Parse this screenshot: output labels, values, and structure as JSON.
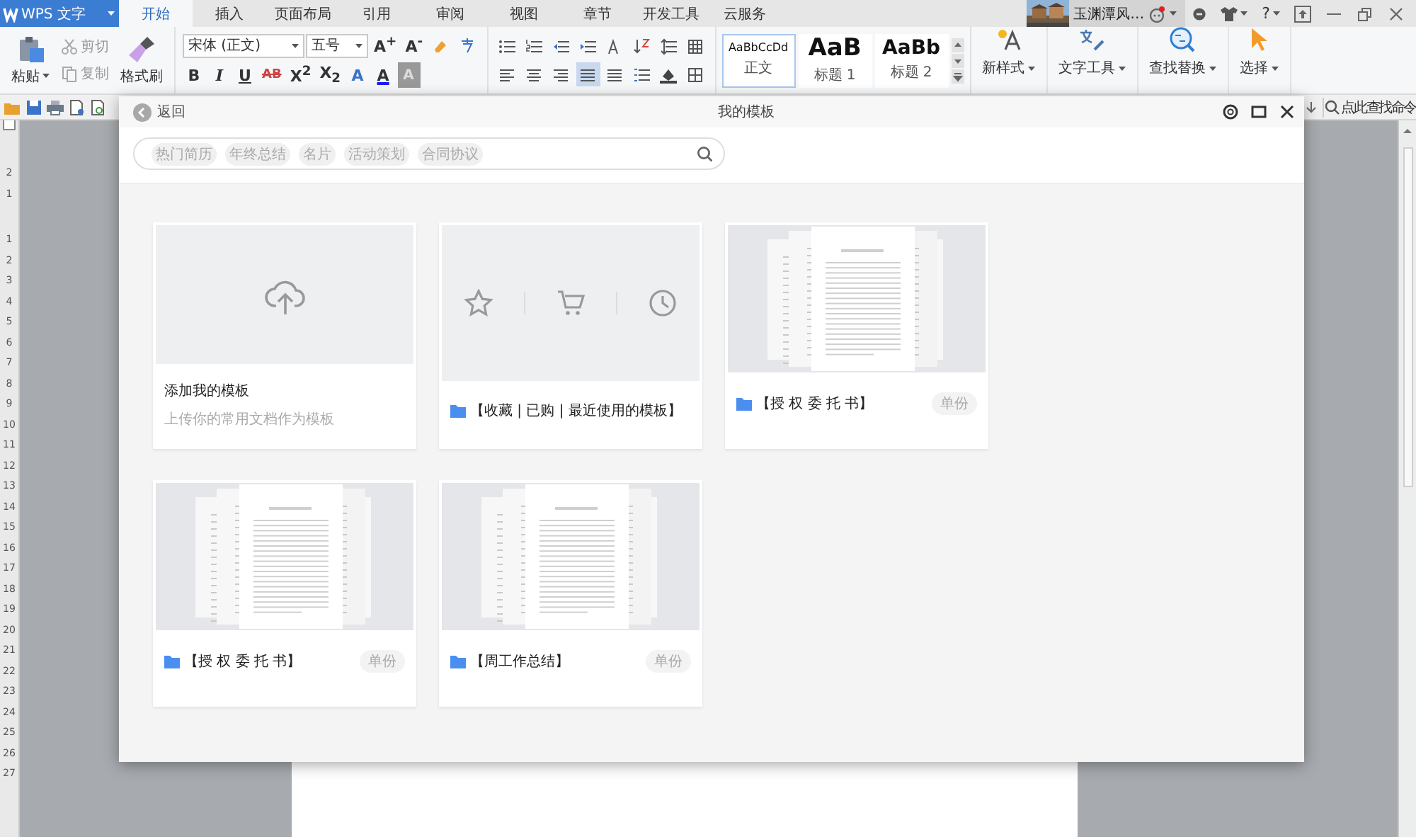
{
  "app": {
    "name": "WPS 文字",
    "help": "?",
    "user": {
      "name": "玉渊潭风…",
      "notification": true
    },
    "tabs": [
      {
        "label": "开始",
        "selected": true
      },
      {
        "label": "插入",
        "selected": false
      },
      {
        "label": "页面布局",
        "selected": false
      },
      {
        "label": "引用",
        "selected": false
      },
      {
        "label": "审阅",
        "selected": false
      },
      {
        "label": "视图",
        "selected": false
      },
      {
        "label": "章节",
        "selected": false
      },
      {
        "label": "开发工具",
        "selected": false
      },
      {
        "label": "云服务",
        "selected": false
      }
    ]
  },
  "ribbon": {
    "clipboard": {
      "paste": "粘贴",
      "cut": "剪切",
      "copy": "复制",
      "format_painter": "格式刷"
    },
    "font": {
      "name": "宋体 (正文)",
      "size": "五号",
      "grow": "A$^{+}$",
      "shrink": "A$^{-}$",
      "format_buttons": [
        "B",
        "I",
        "U",
        "AB",
        "X$^{2}$",
        "X$_{2}$",
        "A",
        "A",
        "A"
      ]
    },
    "alignments": [
      {
        "kind": "left",
        "selected": false
      },
      {
        "kind": "center",
        "selected": false
      },
      {
        "kind": "right",
        "selected": false
      },
      {
        "kind": "justify",
        "selected": true
      },
      {
        "kind": "distributed",
        "selected": false
      }
    ],
    "styles": [
      {
        "sample": "AaBbCcDd",
        "label": "正文",
        "kind": "body",
        "selected": true
      },
      {
        "sample": "AaB",
        "label": "标题 1",
        "kind": "heading1",
        "selected": false
      },
      {
        "sample": "AaBb",
        "label": "标题 2",
        "kind": "heading2",
        "selected": false
      }
    ],
    "tools": [
      {
        "label": "新样式",
        "kind": "style"
      },
      {
        "label": "文字工具",
        "kind": "text"
      },
      {
        "label": "查找替换",
        "kind": "find"
      },
      {
        "label": "选择",
        "kind": "select"
      }
    ]
  },
  "command_search": {
    "label": "点此查找命令"
  },
  "ruler": {
    "labels": [
      "2",
      "1",
      "1",
      "2",
      "3",
      "4",
      "5",
      "6",
      "7",
      "8",
      "9",
      "10",
      "11",
      "12",
      "13",
      "14",
      "15",
      "16",
      "17",
      "18",
      "19",
      "20",
      "21",
      "22",
      "23",
      "24",
      "25",
      "26",
      "27"
    ]
  },
  "dialog": {
    "back": "返回",
    "title": "我的模板",
    "search": {
      "tags": [
        "热门简历",
        "年终总结",
        "名片",
        "活动策划",
        "合同协议"
      ]
    },
    "cards": [
      {
        "kind": "upload",
        "title": "添加我的模板",
        "subtitle": "上传你的常用文档作为模板"
      },
      {
        "kind": "shortcuts",
        "label": "【收藏 | 已购 | 最近使用的模板】"
      },
      {
        "kind": "template",
        "label": "【授 权 委 托 书】",
        "badge": "单份"
      },
      {
        "kind": "template",
        "label": "【授 权 委 托 书】",
        "badge": "单份"
      },
      {
        "kind": "template",
        "label": "【周工作总结】",
        "badge": "单份"
      }
    ]
  }
}
